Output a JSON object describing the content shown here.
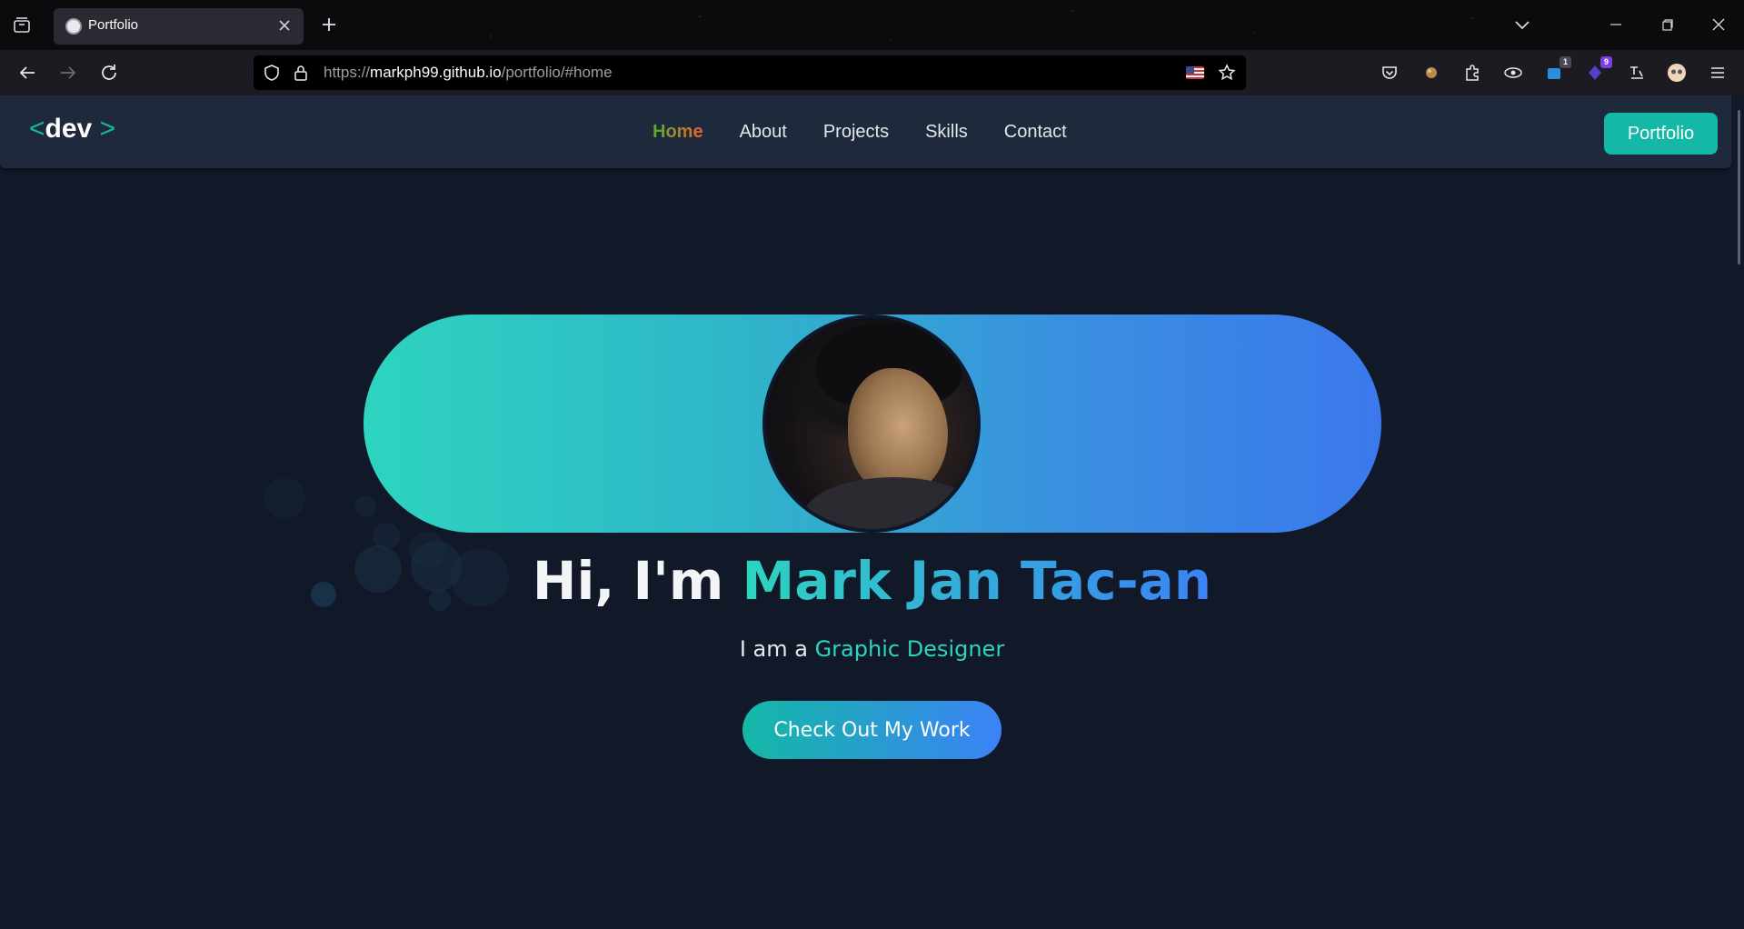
{
  "browser": {
    "tab": {
      "title": "Portfolio"
    },
    "url": {
      "host": "markph99.github.io",
      "path": "/portfolio/#home",
      "scheme": "https://"
    },
    "extension_badges": {
      "badge_1": "1",
      "badge_2": "9"
    }
  },
  "site": {
    "logo": {
      "open": "<",
      "text": "dev",
      "close": ">"
    },
    "nav": [
      {
        "label": "Home",
        "active": true
      },
      {
        "label": "About"
      },
      {
        "label": "Projects"
      },
      {
        "label": "Skills"
      },
      {
        "label": "Contact"
      }
    ],
    "header_button": "Portfolio",
    "hero": {
      "greeting": "Hi, I'm ",
      "name": "Mark Jan Tac-an",
      "tagline_prefix": "I am a ",
      "role": "Graphic Designer",
      "cta": "Check Out My Work"
    }
  },
  "colors": {
    "accent": "#14b8a6",
    "gradient_start": "#2dd4bf",
    "gradient_end": "#3b82f6",
    "background": "#111827",
    "header": "#1e293b"
  }
}
